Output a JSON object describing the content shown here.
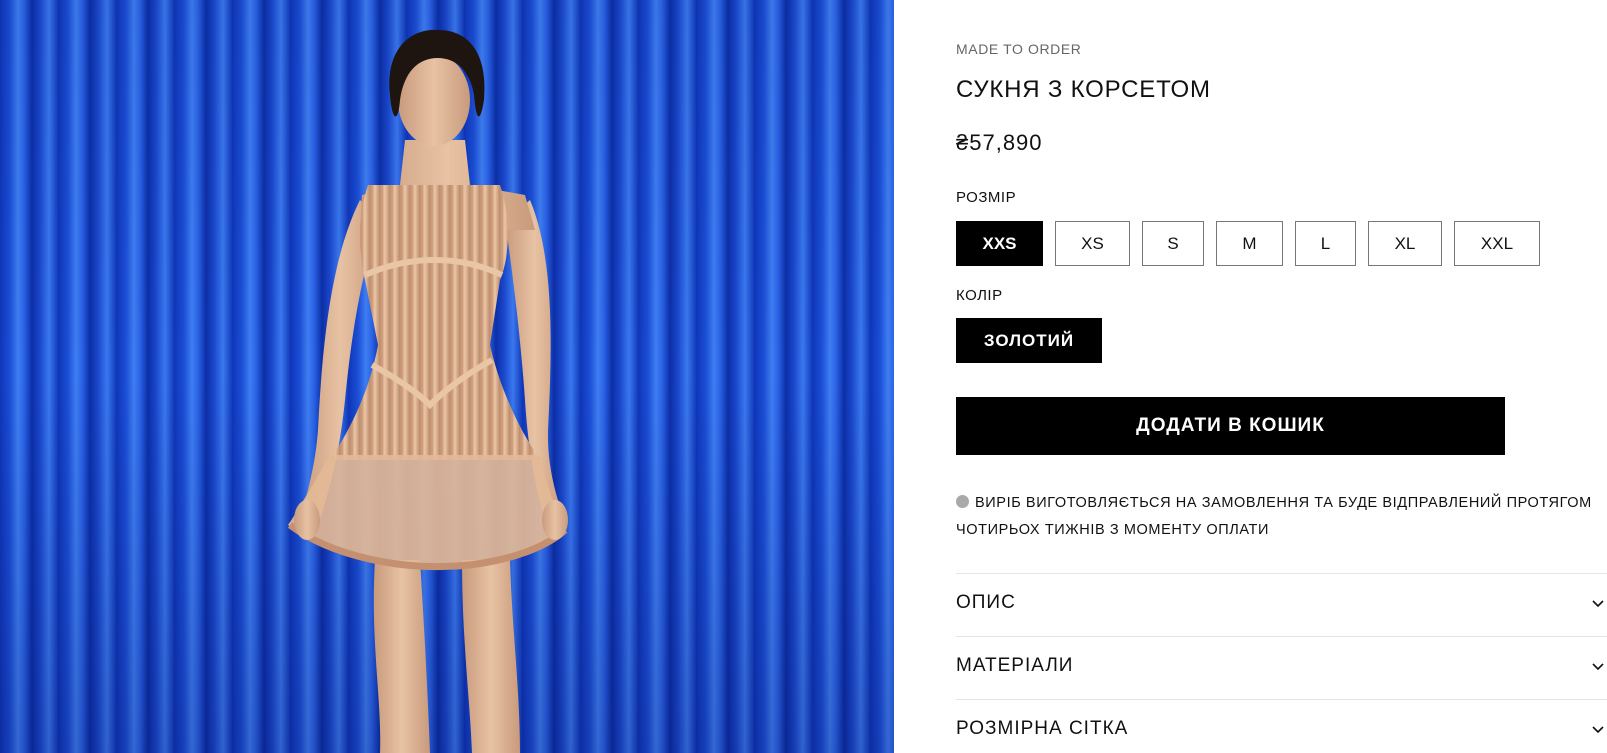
{
  "product": {
    "kicker": "MADE TO ORDER",
    "title": "СУКНЯ З КОРСЕТОМ",
    "price": "₴57,890"
  },
  "size": {
    "label": "РОЗМІР",
    "options": [
      "XXS",
      "XS",
      "S",
      "M",
      "L",
      "XL",
      "XXL"
    ],
    "selected": "XXS"
  },
  "color": {
    "label": "КОЛІР",
    "selected": "ЗОЛОТИЙ"
  },
  "cart": {
    "add_label": "ДОДАТИ В КОШИК"
  },
  "notice": {
    "text": "ВИРІБ ВИГОТОВЛЯЄТЬСЯ НА ЗАМОВЛЕННЯ ТА БУДЕ ВІДПРАВЛЕНИЙ ПРОТЯГОМ ЧОТИРЬОХ ТИЖНІВ З МОМЕНТУ ОПЛАТИ"
  },
  "accordions": [
    {
      "label": "ОПИС",
      "icon": "chevron-down-icon"
    },
    {
      "label": "МАТЕРІАЛИ",
      "icon": "chevron-down-icon"
    },
    {
      "label": "РОЗМІРНА СІТКА",
      "icon": "chevron-down-icon"
    }
  ],
  "colors": {
    "primary": "#000000",
    "curtain": "#1a4ad0",
    "dress": "#d9a986"
  }
}
